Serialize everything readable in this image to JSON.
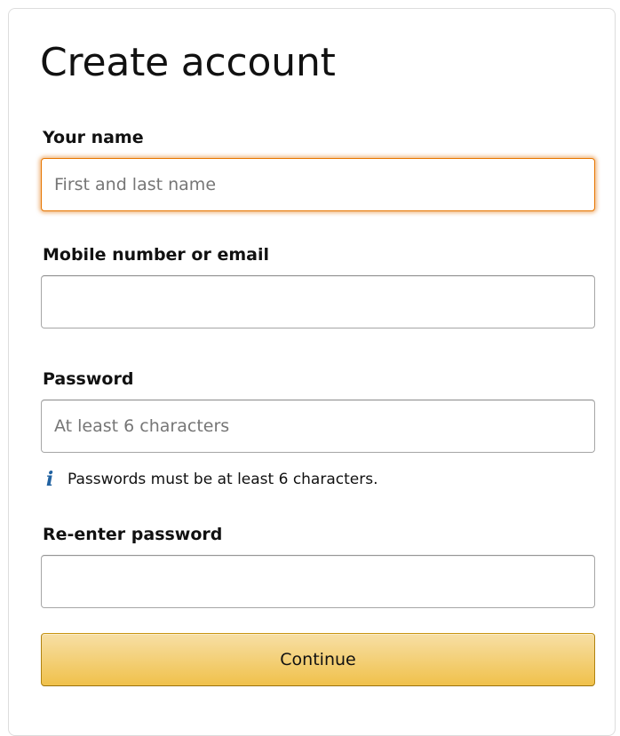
{
  "form": {
    "title": "Create account",
    "fields": {
      "name": {
        "label": "Your name",
        "placeholder": "First and last name",
        "value": ""
      },
      "contact": {
        "label": "Mobile number or email",
        "placeholder": "",
        "value": ""
      },
      "password": {
        "label": "Password",
        "placeholder": "At least 6 characters",
        "value": "",
        "hint": "Passwords must be at least 6 characters.",
        "hint_icon": "info-icon"
      },
      "password_confirm": {
        "label": "Re-enter password",
        "placeholder": "",
        "value": ""
      }
    },
    "submit_label": "Continue"
  },
  "colors": {
    "focus_border": "#e77600",
    "button_top": "#f7dfa5",
    "button_bottom": "#f0c14b",
    "info_icon": "#2162a1"
  }
}
